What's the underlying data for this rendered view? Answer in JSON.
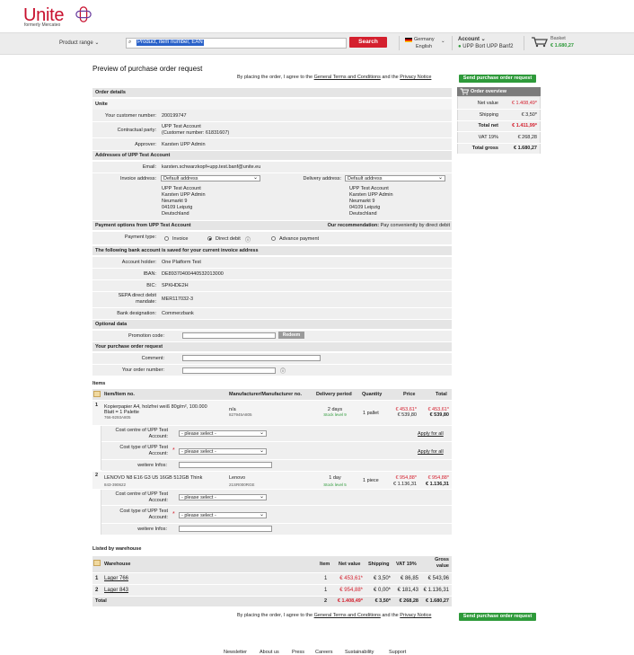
{
  "header": {
    "logo": "Unite",
    "logo_sub": "formerly Mercateo",
    "product_range": "Product range",
    "search_placeholder": "Product, item number, EAN",
    "search_button": "Search",
    "country": "Germany",
    "language": "English",
    "account_label": "Account",
    "account_user": "UPP Bort UPP Banf2",
    "basket_label": "Basket",
    "basket_total": "€ 1.680,27"
  },
  "page": {
    "title": "Preview of purchase order request",
    "agree_prefix": "By placing the order, I agree to the",
    "terms": "General Terms and Conditions",
    "and_the": "and the",
    "privacy": "Privacy Notice",
    "send_button": "Send purchase order request"
  },
  "order_details": {
    "section": "Order details",
    "company": "Unite",
    "customer_number_label": "Your customer number:",
    "customer_number": "200199747",
    "contractual_party_label": "Contractual party:",
    "contractual_party_1": "UPP Test Account",
    "contractual_party_2": "(Customer number: 61831607)",
    "approver_label": "Approver:",
    "approver": "Karsten UPP Admin"
  },
  "addresses": {
    "section": "Addresses of UPP Test Account",
    "email_label": "Email:",
    "email": "karsten.schwarzkopf+upp.test.banf@unite.eu",
    "invoice_label": "Invoice address:",
    "invoice_select": "Default address",
    "delivery_label": "Delivery address:",
    "delivery_select": "Default address",
    "invoice_lines": [
      "UPP Test Account",
      "Karsten UPP Admin",
      "Neumarkt 9",
      "04109 Leipzig",
      "Deutschland"
    ],
    "delivery_lines": [
      "UPP Test Account",
      "Karsten UPP Admin",
      "Neumarkt 9",
      "04109 Leipzig",
      "Deutschland"
    ]
  },
  "payment": {
    "section": "Payment options from UPP Test Account",
    "recommendation_label": "Our recommendation:",
    "recommendation": "Pay conveniently by direct debit",
    "type_label": "Payment type:",
    "opt_invoice": "Invoice",
    "opt_direct_debit": "Direct debit",
    "opt_advance": "Advance payment",
    "bank_section": "The following bank account is saved for your current invoice address",
    "holder_label": "Account holder:",
    "holder": "One Platform Test",
    "iban_label": "IBAN:",
    "iban": "DE89370400440532013000",
    "bic_label": "BIC:",
    "bic": "SPKHDE2H",
    "sepa_label_1": "SEPA direct debit",
    "sepa_label_2": "mandate:",
    "sepa": "MER117032-3",
    "bank_label": "Bank designation:",
    "bank": "Commerzbank"
  },
  "optional": {
    "section": "Optional data",
    "promo_label": "Promotion code:",
    "redeem": "Redeem",
    "request_section": "Your purchase order request",
    "comment_label": "Comment:",
    "order_number_label": "Your order number:"
  },
  "items": {
    "section": "Items",
    "headers": {
      "item": "Item/Item no.",
      "manufacturer": "Manufacturer/Manufacturer no.",
      "delivery": "Delivery period",
      "quantity": "Quantity",
      "price": "Price",
      "total": "Total"
    },
    "rows": [
      {
        "pos": "1",
        "name_1": "Kopierpapier A4, holzfrei weiß 80g/m², 100.000",
        "name_2": "Blatt = 1 Palette",
        "no": "766-9293A805",
        "manufacturer": "n/a",
        "manufacturer_no": "827945A805",
        "delivery": "2 days",
        "stock": "Stock level 9",
        "quantity": "1 pallet",
        "price_net": "€ 453,61*",
        "price_gross": "€ 539,80",
        "total_net": "€ 453,61*",
        "total_gross": "€ 539,80"
      },
      {
        "pos": "2",
        "name_1": "LENOVO N8 E16 G3 U5 16GB 512GB Think",
        "name_2": "",
        "no": "843-390622",
        "manufacturer": "Lenovo",
        "manufacturer_no": "21SR000RGE",
        "delivery": "1 day",
        "stock": "Stock level 5",
        "quantity": "1 piece",
        "price_net": "€ 954,88*",
        "price_gross": "€ 1.136,31",
        "total_net": "€ 954,88*",
        "total_gross": "€ 1.136,31"
      }
    ],
    "cost_centre_label_1": "Cost centre of UPP Test",
    "cost_centre_label_2": "Account:",
    "cost_type_label_1": "Cost type of UPP Test",
    "cost_type_label_2": "Account:",
    "select_placeholder": "- please select -",
    "apply_all": "Apply for all",
    "more_info_label": "weitere Infos:"
  },
  "warehouse": {
    "section": "Listed by warehouse",
    "headers": {
      "warehouse": "Warehouse",
      "item": "Item",
      "net": "Net value",
      "shipping": "Shipping",
      "vat": "VAT 19%",
      "gross_1": "Gross",
      "gross_2": "value"
    },
    "rows": [
      {
        "pos": "1",
        "name": "Lager 766",
        "item": "1",
        "net": "€ 453,61*",
        "shipping": "€ 3,50*",
        "vat": "€ 86,85",
        "gross": "€ 543,96"
      },
      {
        "pos": "2",
        "name": "Lager 843",
        "item": "1",
        "net": "€ 954,88*",
        "shipping": "€ 0,00*",
        "vat": "€ 181,43",
        "gross": "€ 1.136,31"
      }
    ],
    "total": {
      "label": "Total",
      "item": "2",
      "net": "€ 1.408,49*",
      "shipping": "€ 3,50*",
      "vat": "€ 268,28",
      "gross": "€ 1.680,27"
    }
  },
  "overview": {
    "title": "Order overview",
    "net_label": "Net value",
    "net": "€ 1.408,49*",
    "shipping_label": "Shipping",
    "shipping": "€ 3,50*",
    "total_net_label": "Total net",
    "total_net": "€ 1.411,99*",
    "vat_label": "VAT 19%",
    "vat": "€ 268,28",
    "total_gross_label": "Total gross",
    "total_gross": "€ 1.680,27"
  },
  "footer": [
    "Newsletter",
    "About us",
    "Press",
    "Careers",
    "Sustainability",
    "Support"
  ],
  "colors": {
    "brand": "#c8102e",
    "search": "#d4202e",
    "send": "#2e9a3a"
  }
}
